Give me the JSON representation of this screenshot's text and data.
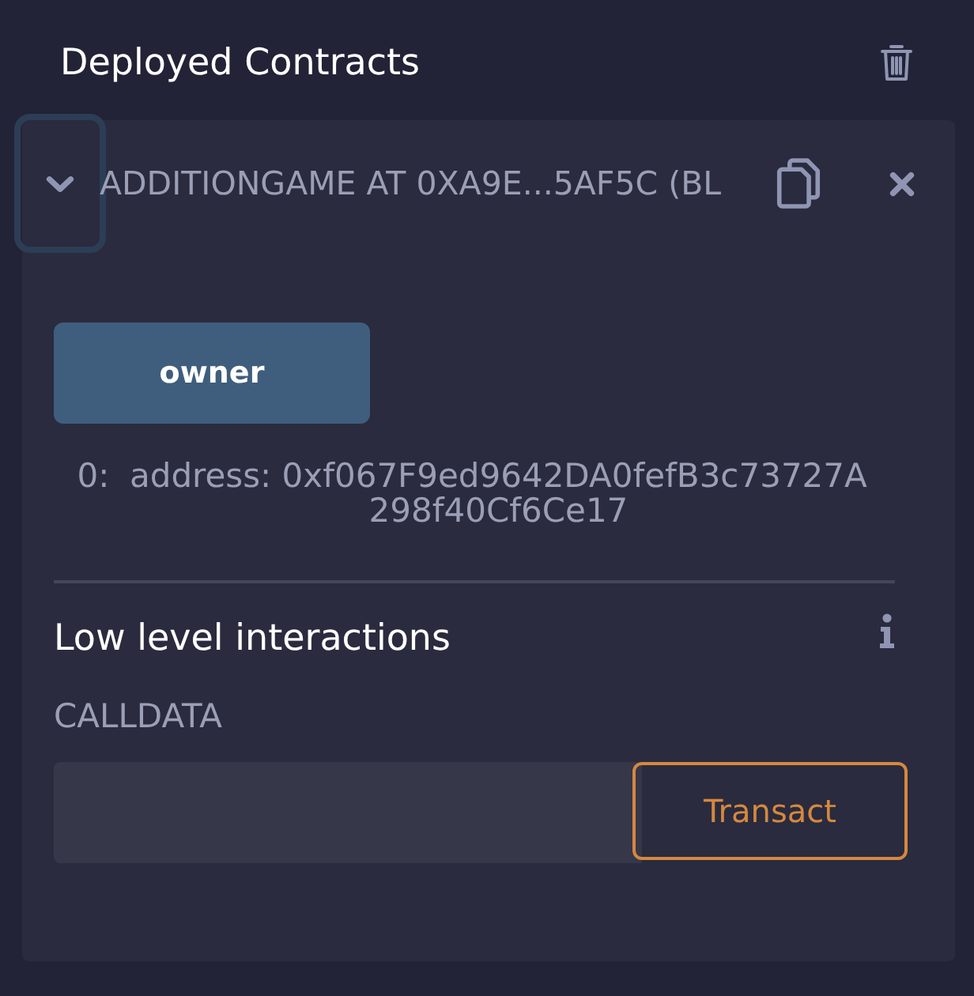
{
  "panel": {
    "title": "Deployed Contracts"
  },
  "contract": {
    "title": "ADDITIONGAME AT 0XA9E...5AF5C (BL",
    "expanded": true,
    "toggle_focused": true,
    "functions": [
      {
        "label": "owner",
        "kind": "call",
        "outputs": [
          {
            "index": "0:",
            "value": "address: 0xf067F9ed9642DA0fefB3c73727A298f40Cf6Ce17"
          }
        ]
      }
    ],
    "low_level": {
      "title": "Low level interactions",
      "field_label": "CALLDATA",
      "button": "Transact"
    }
  }
}
